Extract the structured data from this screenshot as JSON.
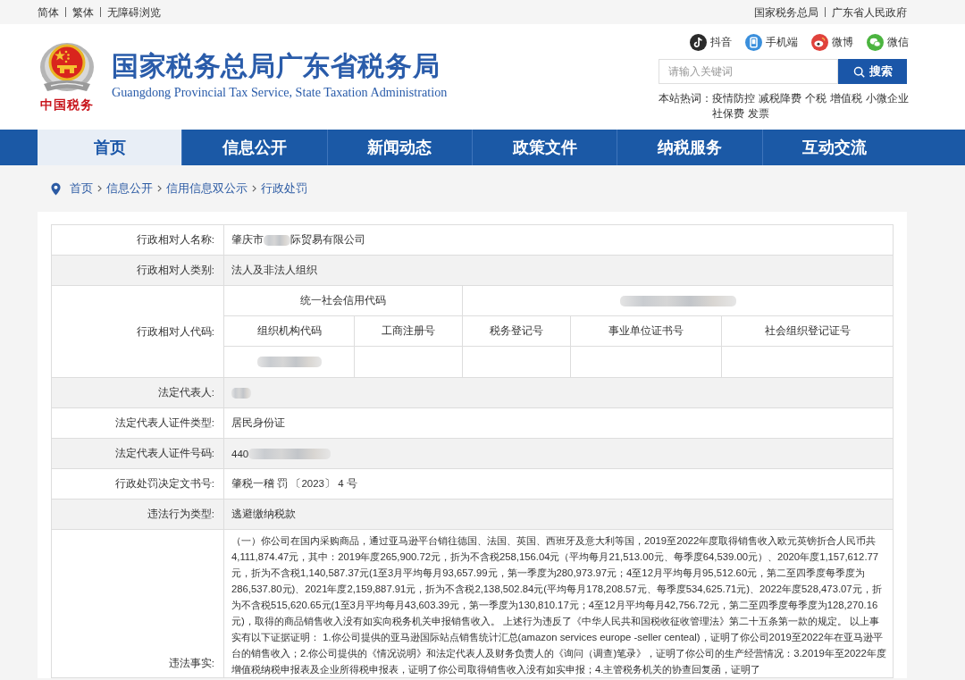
{
  "top_bar": {
    "left_links": [
      "简体",
      "繁体",
      "无障碍浏览"
    ],
    "right_links": [
      "国家税务总局",
      "广东省人民政府"
    ]
  },
  "header": {
    "tagline": "中国税务",
    "title": "国家税务总局广东省税务局",
    "subtitle": "Guangdong Provincial Tax Service, State Taxation Administration",
    "social": [
      {
        "kind": "note",
        "label": "抖音"
      },
      {
        "kind": "phone",
        "label": "手机端"
      },
      {
        "kind": "eye",
        "label": "微博"
      },
      {
        "kind": "chat",
        "label": "微信"
      }
    ],
    "search": {
      "placeholder": "请输入关键词",
      "button": "搜索"
    },
    "hot_words": {
      "label": "本站热词：",
      "words": [
        "疫情防控",
        "减税降费",
        "个税",
        "增值税",
        "小微企业",
        "社保费",
        "发票"
      ]
    }
  },
  "nav": [
    {
      "label": "首页",
      "selected": true
    },
    {
      "label": "信息公开",
      "selected": false
    },
    {
      "label": "新闻动态",
      "selected": false
    },
    {
      "label": "政策文件",
      "selected": false
    },
    {
      "label": "纳税服务",
      "selected": false
    },
    {
      "label": "互动交流",
      "selected": false
    }
  ],
  "breadcrumb": [
    "首页",
    "信息公开",
    "信用信息双公示",
    "行政处罚"
  ],
  "record": [
    {
      "kind": "text",
      "label": "行政相对人名称:",
      "value": [
        {
          "kind": "text",
          "text": "肇庆市"
        },
        {
          "kind": "redacted"
        },
        {
          "kind": "text",
          "text": "际贸易有限公司"
        }
      ]
    },
    {
      "kind": "text",
      "label": "行政相对人类别:",
      "value": [
        {
          "kind": "text",
          "text": "法人及非法人组织"
        }
      ]
    },
    {
      "kind": "codes",
      "label": "行政相对人代码:",
      "credit_code": {
        "label": "统一社会信用代码",
        "value": {
          "kind": "redacted"
        }
      },
      "codes": [
        {
          "label": "组织机构代码",
          "value": {
            "kind": "redacted"
          }
        },
        {
          "label": "工商注册号"
        },
        {
          "label": "税务登记号"
        },
        {
          "label": "事业单位证书号"
        },
        {
          "label": "社会组织登记证号"
        }
      ]
    },
    {
      "kind": "text",
      "label": "法定代表人:",
      "value": [
        {
          "kind": "redacted"
        }
      ]
    },
    {
      "kind": "text",
      "label": "法定代表人证件类型:",
      "value": [
        {
          "kind": "text",
          "text": "居民身份证"
        }
      ]
    },
    {
      "kind": "text",
      "label": "法定代表人证件号码:",
      "value": [
        {
          "kind": "text",
          "text": "440"
        },
        {
          "kind": "redacted"
        }
      ]
    },
    {
      "kind": "text",
      "label": "行政处罚决定文书号:",
      "value": [
        {
          "kind": "text",
          "text": "肇税一稽 罚 〔2023〕 4 号"
        }
      ]
    },
    {
      "kind": "text",
      "label": "违法行为类型:",
      "value": [
        {
          "kind": "text",
          "text": "逃避缴纳税款"
        }
      ]
    },
    {
      "kind": "paragraph",
      "label": "违法事实:",
      "text": "（一）你公司在国内采购商品，通过亚马逊平台销往德国、法国、英国、西班牙及意大利等国，2019至2022年度取得销售收入欧元英镑折合人民币共4,111,874.47元，其中：2019年度265,900.72元，折为不含税258,156.04元（平均每月21,513.00元、每季度64,539.00元）、2020年度1,157,612.77元，折为不含税1,140,587.37元(1至3月平均每月93,657.99元，第一季度为280,973.97元；4至12月平均每月95,512.60元，第二至四季度每季度为286,537.80元)、2021年度2,159,887.91元，折为不含税2,138,502.84元(平均每月178,208.57元、每季度534,625.71元)、2022年度528,473.07元，折为不含税515,620.65元(1至3月平均每月43,603.39元，第一季度为130,810.17元；4至12月平均每月42,756.72元，第二至四季度每季度为128,270.16元)，取得的商品销售收入没有如实向税务机关申报销售收入。 上述行为违反了《中华人民共和国税收征收管理法》第二十五条第一款的规定。 以上事实有以下证据证明： 1.你公司提供的亚马逊国际站点销售统计汇总(amazon services europe -seller centeal)，证明了你公司2019至2022年在亚马逊平台的销售收入；2.你公司提供的《情况说明》和法定代表人及财务负责人的《询问（调查)笔录》，证明了你公司的生产经营情况：3.2019年至2022年度增值税纳税申报表及企业所得税申报表，证明了你公司取得销售收入没有如实申报；4.主管税务机关的协查回复函，证明了"
    }
  ]
}
